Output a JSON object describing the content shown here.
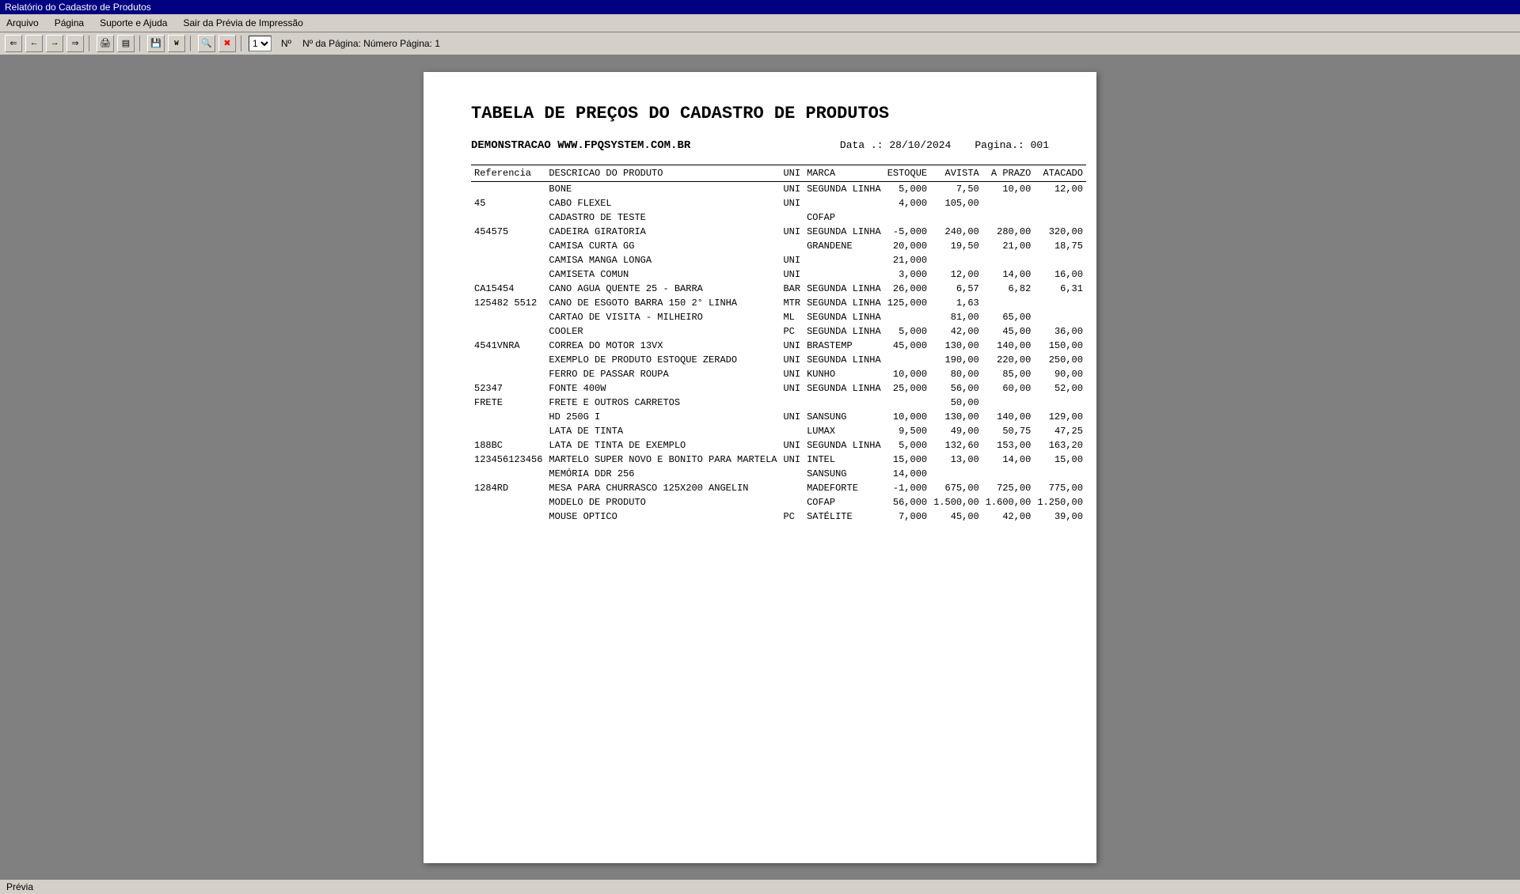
{
  "titlebar": {
    "label": "Relatório do Cadastro de Produtos"
  },
  "menubar": {
    "items": [
      "Arquivo",
      "Página",
      "Suporte e Ajuda",
      "Sair da Prévia de Impressão"
    ]
  },
  "toolbar": {
    "page_select_value": "1",
    "page_label": "Nº",
    "page_info": "Nº da Página: Número Página: 1"
  },
  "report": {
    "title": "TABELA DE PREÇOS DO CADASTRO DE PRODUTOS",
    "subtitle": "DEMONSTRACAO WWW.FPQSYSTEM.COM.BR",
    "date_label": "Data .:",
    "date_value": "28/10/2024",
    "pagina_label": "Pagina.:",
    "pagina_value": "001",
    "columns": {
      "referencia": "Referencia",
      "descricao": "DESCRICAO DO PRODUTO",
      "uni": "UNI",
      "marca": "MARCA",
      "estoque": "ESTOQUE",
      "avista": "AVISTA",
      "aprazo": "A PRAZO",
      "atacado": "ATACADO"
    },
    "rows": [
      {
        "ref": "",
        "desc": "BONE",
        "uni": "UNI",
        "marca": "SEGUNDA LINHA",
        "estoque": "5,000",
        "avista": "7,50",
        "aprazo": "10,00",
        "atacado": "12,00"
      },
      {
        "ref": "45",
        "desc": "CABO FLEXEL",
        "uni": "UNI",
        "marca": "",
        "estoque": "4,000",
        "avista": "105,00",
        "aprazo": "",
        "atacado": ""
      },
      {
        "ref": "",
        "desc": "CADASTRO DE TESTE",
        "uni": "",
        "marca": "COFAP",
        "estoque": "",
        "avista": "",
        "aprazo": "",
        "atacado": ""
      },
      {
        "ref": "454575",
        "desc": "CADEIRA GIRATORIA",
        "uni": "UNI",
        "marca": "SEGUNDA LINHA",
        "estoque": "-5,000",
        "avista": "240,00",
        "aprazo": "280,00",
        "atacado": "320,00"
      },
      {
        "ref": "",
        "desc": "CAMISA CURTA GG",
        "uni": "",
        "marca": "GRANDENE",
        "estoque": "20,000",
        "avista": "19,50",
        "aprazo": "21,00",
        "atacado": "18,75"
      },
      {
        "ref": "",
        "desc": "CAMISA MANGA LONGA",
        "uni": "UNI",
        "marca": "",
        "estoque": "21,000",
        "avista": "",
        "aprazo": "",
        "atacado": ""
      },
      {
        "ref": "",
        "desc": "CAMISETA COMUN",
        "uni": "UNI",
        "marca": "",
        "estoque": "3,000",
        "avista": "12,00",
        "aprazo": "14,00",
        "atacado": "16,00"
      },
      {
        "ref": "CA15454",
        "desc": "CANO AGUA QUENTE 25 - BARRA",
        "uni": "BAR",
        "marca": "SEGUNDA LINHA",
        "estoque": "26,000",
        "avista": "6,57",
        "aprazo": "6,82",
        "atacado": "6,31"
      },
      {
        "ref": "125482 5512",
        "desc": "CANO DE ESGOTO BARRA 150 2° LINHA",
        "uni": "MTR",
        "marca": "SEGUNDA LINHA",
        "estoque": "125,000",
        "avista": "1,63",
        "aprazo": "",
        "atacado": ""
      },
      {
        "ref": "",
        "desc": "CARTAO DE VISITA - MILHEIRO",
        "uni": "ML",
        "marca": "SEGUNDA LINHA",
        "estoque": "",
        "avista": "81,00",
        "aprazo": "65,00",
        "atacado": ""
      },
      {
        "ref": "",
        "desc": "COOLER",
        "uni": "PC",
        "marca": "SEGUNDA LINHA",
        "estoque": "5,000",
        "avista": "42,00",
        "aprazo": "45,00",
        "atacado": "36,00"
      },
      {
        "ref": "4541VNRA",
        "desc": "CORREA DO MOTOR 13VX",
        "uni": "UNI",
        "marca": "BRASTEMP",
        "estoque": "45,000",
        "avista": "130,00",
        "aprazo": "140,00",
        "atacado": "150,00"
      },
      {
        "ref": "",
        "desc": "EXEMPLO DE PRODUTO ESTOQUE ZERADO",
        "uni": "UNI",
        "marca": "SEGUNDA LINHA",
        "estoque": "",
        "avista": "190,00",
        "aprazo": "220,00",
        "atacado": "250,00"
      },
      {
        "ref": "",
        "desc": "FERRO DE PASSAR ROUPA",
        "uni": "UNI",
        "marca": "KUNHO",
        "estoque": "10,000",
        "avista": "80,00",
        "aprazo": "85,00",
        "atacado": "90,00"
      },
      {
        "ref": "52347",
        "desc": "FONTE 400W",
        "uni": "UNI",
        "marca": "SEGUNDA LINHA",
        "estoque": "25,000",
        "avista": "56,00",
        "aprazo": "60,00",
        "atacado": "52,00"
      },
      {
        "ref": "FRETE",
        "desc": "FRETE E OUTROS CARRETOS",
        "uni": "",
        "marca": "",
        "estoque": "",
        "avista": "50,00",
        "aprazo": "",
        "atacado": ""
      },
      {
        "ref": "",
        "desc": "HD 250G    I",
        "uni": "UNI",
        "marca": "SANSUNG",
        "estoque": "10,000",
        "avista": "130,00",
        "aprazo": "140,00",
        "atacado": "129,00"
      },
      {
        "ref": "",
        "desc": "LATA DE TINTA",
        "uni": "",
        "marca": "LUMAX",
        "estoque": "9,500",
        "avista": "49,00",
        "aprazo": "50,75",
        "atacado": "47,25"
      },
      {
        "ref": "188BC",
        "desc": "LATA DE TINTA DE EXEMPLO",
        "uni": "UNI",
        "marca": "SEGUNDA LINHA",
        "estoque": "5,000",
        "avista": "132,60",
        "aprazo": "153,00",
        "atacado": "163,20"
      },
      {
        "ref": "123456123456",
        "desc": "MARTELO SUPER NOVO E BONITO PARA MARTELA",
        "uni": "UNI",
        "marca": "INTEL",
        "estoque": "15,000",
        "avista": "13,00",
        "aprazo": "14,00",
        "atacado": "15,00"
      },
      {
        "ref": "",
        "desc": "MEMÓRIA DDR 256",
        "uni": "",
        "marca": "SANSUNG",
        "estoque": "14,000",
        "avista": "",
        "aprazo": "",
        "atacado": ""
      },
      {
        "ref": "1284RD",
        "desc": "MESA PARA CHURRASCO 125X200 ANGELIN",
        "uni": "",
        "marca": "MADEFORTE",
        "estoque": "-1,000",
        "avista": "675,00",
        "aprazo": "725,00",
        "atacado": "775,00"
      },
      {
        "ref": "",
        "desc": "MODELO DE PRODUTO",
        "uni": "",
        "marca": "COFAP",
        "estoque": "56,000",
        "avista": "1.500,00",
        "aprazo": "1.600,00",
        "atacado": "1.250,00"
      },
      {
        "ref": "",
        "desc": "MOUSE OPTICO",
        "uni": "PC",
        "marca": "SATÉLITE",
        "estoque": "7,000",
        "avista": "45,00",
        "aprazo": "42,00",
        "atacado": "39,00"
      }
    ]
  },
  "statusbar": {
    "label": "Prévia"
  }
}
